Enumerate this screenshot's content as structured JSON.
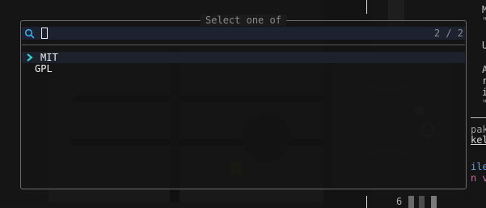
{
  "picker": {
    "title": "Select one of",
    "query": "",
    "count": "2 / 2",
    "items": [
      {
        "label": "MIT",
        "selected": true
      },
      {
        "label": "GPL",
        "selected": false
      }
    ]
  },
  "background": {
    "right_fragments": [
      "M",
      "\"",
      "U",
      "A",
      "r",
      "i",
      "\"",
      "pak",
      "kel",
      "ile",
      "n v"
    ],
    "status_number": "6"
  },
  "colors": {
    "accent": "#2fd0d0",
    "border": "#6c6c6c",
    "selected_row": "#1c212c"
  },
  "icons": [
    "search-icon",
    "chevron-right-icon"
  ]
}
